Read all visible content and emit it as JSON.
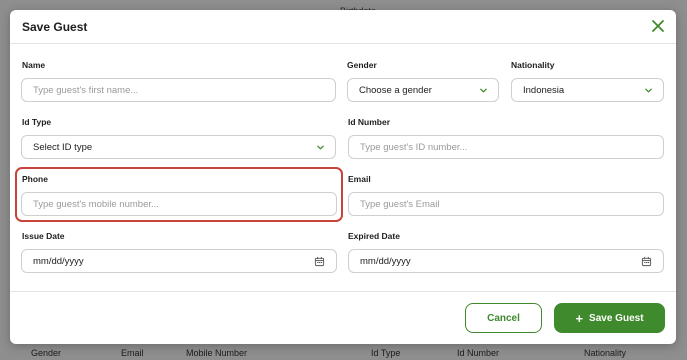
{
  "background": {
    "top_text": "Birthdate",
    "columns": [
      "Gender",
      "Email",
      "Mobile Number",
      "Id Type",
      "Id Number",
      "Nationality"
    ]
  },
  "modal": {
    "title": "Save Guest",
    "close_icon": "close-icon"
  },
  "form": {
    "name": {
      "label": "Name",
      "placeholder": "Type guest's first name..."
    },
    "gender": {
      "label": "Gender",
      "value": "Choose a gender"
    },
    "nationality": {
      "label": "Nationality",
      "value": "Indonesia"
    },
    "id_type": {
      "label": "Id Type",
      "value": "Select ID type"
    },
    "id_number": {
      "label": "Id Number",
      "placeholder": "Type guest's ID number..."
    },
    "phone": {
      "label": "Phone",
      "placeholder": "Type guest's mobile number..."
    },
    "email": {
      "label": "Email",
      "placeholder": "Type guest's Email"
    },
    "issue_date": {
      "label": "Issue Date",
      "value": "mm/dd/yyyy"
    },
    "expired_date": {
      "label": "Expired Date",
      "value": "mm/dd/yyyy"
    }
  },
  "footer": {
    "cancel_label": "Cancel",
    "save_label": "Save Guest",
    "save_icon": "plus-icon"
  },
  "colors": {
    "accent": "#3f8a2c",
    "highlight": "#c8433a"
  }
}
